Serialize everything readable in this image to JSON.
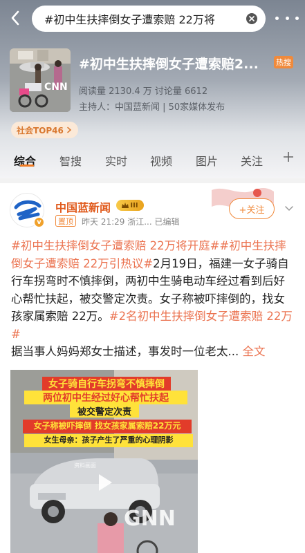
{
  "search": {
    "query": "#初中生扶摔倒女子遭索赔 22万将"
  },
  "topic": {
    "title": "#初中生扶摔倒女子遭索赔2...",
    "hot_label": "热搜",
    "stats": "阅读量 2130.4 万  讨论量 6612",
    "host": "主持人：中国蓝新闻 | 50家媒体发布",
    "rank_tag": "社会TOP46",
    "thumb_watermark": "CNN"
  },
  "tabs": [
    {
      "label": "综合"
    },
    {
      "label": "智搜"
    },
    {
      "label": "实时"
    },
    {
      "label": "视频"
    },
    {
      "label": "图片"
    },
    {
      "label": "关注"
    }
  ],
  "post": {
    "author": "中国蓝新闻",
    "level": "III",
    "verify": "v",
    "pin_label": "置顶",
    "meta": "昨天 21:29  浙江...  已编辑",
    "follow_label": "+关注",
    "body": {
      "tag1": "#初中生扶摔倒女子遭索赔 22万将开庭#",
      "tag2": "#初中生扶摔倒女子遭索赔 22万引热议#",
      "text1": "2月19日，福建一女子骑自行车拐弯时不慎摔倒，两初中生骑电动车经过看到后好心帮忙扶起，被交警定次责。女子称被吓摔倒的，找女孩家属索赔 22万。",
      "tag3": "#2名初中生扶摔倒女子遭索赔 22万#",
      "text2": "据当事人妈妈郑女士描述，事发时一位老太...",
      "full_label": "全文"
    },
    "video": {
      "line1": "女子骑自行车拐弯不慎摔倒",
      "line2": "两位初中生经过好心帮忙扶起",
      "line3": "被交警定次责",
      "line4": "女子称被吓摔倒 找女孩家属索赔22万元",
      "line5": "女生母亲：孩子产生了严重的心理阴影",
      "watermark": "GNN",
      "source_mark": "资料画面"
    }
  },
  "colors": {
    "accent": "#eb7350",
    "orange": "#f08a3c",
    "author": "#e05a1c",
    "caption_red": "#e23c2a",
    "caption_yellow": "#ffe23a"
  }
}
